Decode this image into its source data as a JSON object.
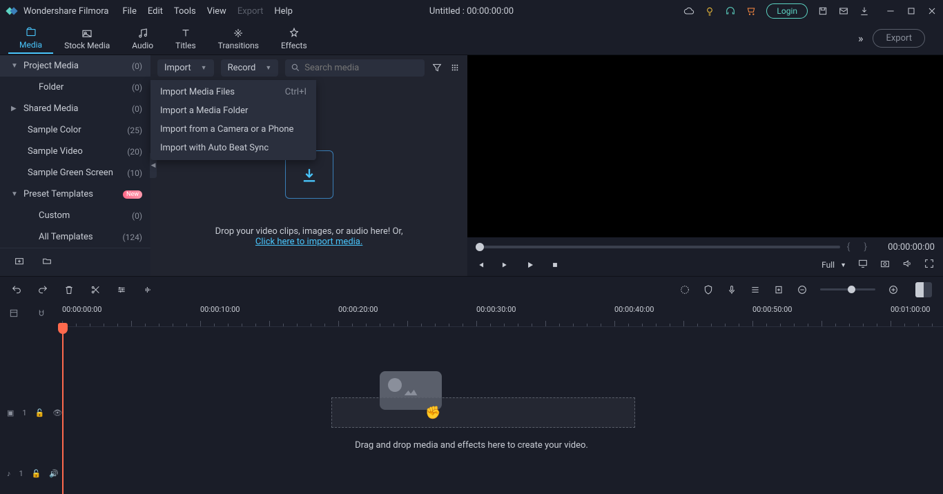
{
  "app": {
    "title": "Wondershare Filmora",
    "doc_title": "Untitled : 00:00:00:00"
  },
  "menu": {
    "file": "File",
    "edit": "Edit",
    "tools": "Tools",
    "view": "View",
    "export": "Export",
    "help": "Help"
  },
  "titleRight": {
    "login": "Login"
  },
  "tabs": {
    "media": "Media",
    "stock": "Stock Media",
    "audio": "Audio",
    "titles": "Titles",
    "transitions": "Transitions",
    "effects": "Effects",
    "export": "Export"
  },
  "sidebar": {
    "project_media": {
      "label": "Project Media",
      "count": "(0)"
    },
    "folder": {
      "label": "Folder",
      "count": "(0)"
    },
    "shared": {
      "label": "Shared Media",
      "count": "(0)"
    },
    "sample_color": {
      "label": "Sample Color",
      "count": "(25)"
    },
    "sample_video": {
      "label": "Sample Video",
      "count": "(20)"
    },
    "sample_green": {
      "label": "Sample Green Screen",
      "count": "(10)"
    },
    "preset": {
      "label": "Preset Templates",
      "badge": "New"
    },
    "custom": {
      "label": "Custom",
      "count": "(0)"
    },
    "all_tpl": {
      "label": "All Templates",
      "count": "(124)"
    }
  },
  "mediaToolbar": {
    "import": "Import",
    "record": "Record",
    "search_ph": "Search media"
  },
  "importMenu": {
    "files": {
      "label": "Import Media Files",
      "sc": "Ctrl+I"
    },
    "folder": {
      "label": "Import a Media Folder"
    },
    "camera": {
      "label": "Import from a Camera or a Phone"
    },
    "beat": {
      "label": "Import with Auto Beat Sync"
    }
  },
  "dropText": {
    "line1": "Drop your video clips, images, or audio here! Or,",
    "link": "Click here to import media."
  },
  "preview": {
    "timecode": "00:00:00:00",
    "fit": "Full"
  },
  "timeline": {
    "labels": [
      "00:00:00:00",
      "00:00:10:00",
      "00:00:20:00",
      "00:00:30:00",
      "00:00:40:00",
      "00:00:50:00",
      "00:01:00:00"
    ],
    "hint": "Drag and drop media and effects here to create your video.",
    "video_track": "1",
    "audio_track": "1"
  }
}
